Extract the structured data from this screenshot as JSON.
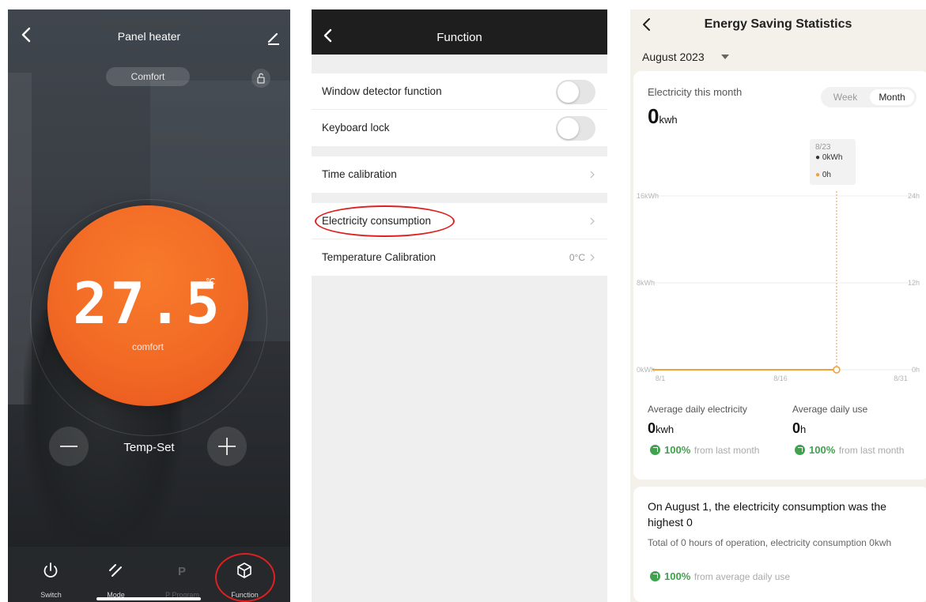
{
  "heater": {
    "title": "Panel heater",
    "mode_pill": "Comfort",
    "temperature": "27.5",
    "unit": "℃",
    "dial_mode": "comfort",
    "temp_set_label": "Temp-Set",
    "tabs": [
      {
        "label": "Switch",
        "icon": "power-icon",
        "dim": false
      },
      {
        "label": "Mode",
        "icon": "mode-slash-icon",
        "dim": false
      },
      {
        "label": "P Program",
        "icon": "p-program-icon",
        "dim": true
      },
      {
        "label": "Function",
        "icon": "cube-icon",
        "dim": false
      }
    ]
  },
  "function": {
    "title": "Function",
    "window_detector": {
      "label": "Window detector function",
      "on": false
    },
    "keyboard_lock": {
      "label": "Keyboard lock",
      "on": false
    },
    "time_calibration": {
      "label": "Time calibration"
    },
    "electricity": {
      "label": "Electricity consumption"
    },
    "temp_calibration": {
      "label": "Temperature Calibration",
      "value": "0°C"
    }
  },
  "stats": {
    "title": "Energy Saving Statistics",
    "month": "August 2023",
    "electricity_label": "Electricity this month",
    "electricity_value": "0",
    "electricity_unit": "kwh",
    "seg_week": "Week",
    "seg_month": "Month",
    "tooltip": {
      "date": "8/23",
      "kwh": "0kWh",
      "hours": "0h"
    },
    "avg_elec_label": "Average daily electricity",
    "avg_elec_value": "0",
    "avg_elec_unit": "kwh",
    "avg_use_label": "Average daily use",
    "avg_use_value": "0",
    "avg_use_unit": "h",
    "pct1": "100%",
    "pct1_text": "from last month",
    "pct2": "100%",
    "pct2_text": "from last month",
    "summary_title": "On August 1, the electricity consumption was the highest 0",
    "summary_body": "Total of 0 hours of operation, electricity consumption 0kwh",
    "pct3": "100%",
    "pct3_text": "from average daily use"
  },
  "chart_data": {
    "type": "line",
    "x_ticks": [
      "8/1",
      "8/16",
      "8/31"
    ],
    "y_left_ticks": [
      "16kWh",
      "8kWh",
      "0kWh"
    ],
    "y_right_ticks": [
      "24h",
      "12h",
      "0h"
    ],
    "ylim_left": [
      0,
      16
    ],
    "ylim_right": [
      0,
      24
    ],
    "series": [
      {
        "name": "electricity",
        "unit": "kWh",
        "color": "#f0a03c",
        "x": [
          "8/1",
          "8/23"
        ],
        "values": [
          0,
          0
        ]
      }
    ],
    "highlight": {
      "x": "8/23",
      "kwh": 0,
      "hours": 0
    }
  }
}
